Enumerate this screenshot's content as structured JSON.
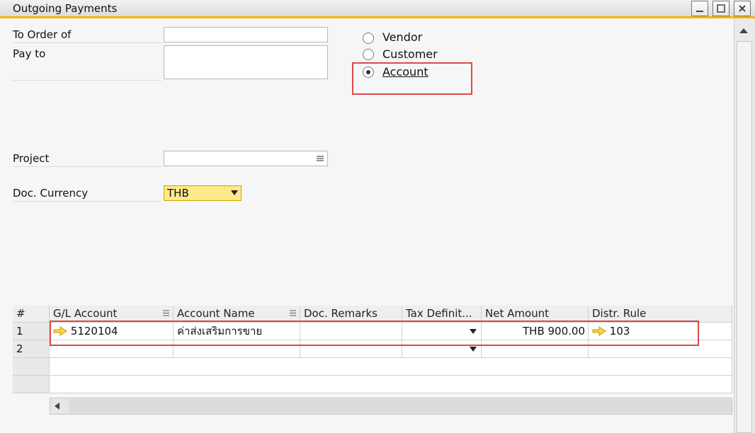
{
  "window": {
    "title": "Outgoing Payments"
  },
  "form": {
    "to_order_of_label": "To Order of",
    "pay_to_label": "Pay to",
    "project_label": "Project",
    "doc_currency_label": "Doc. Currency",
    "doc_currency_value": "THB",
    "to_order_of_value": "",
    "pay_to_value": "",
    "project_value": ""
  },
  "payment_type": {
    "options": [
      {
        "label": "Vendor",
        "selected": false
      },
      {
        "label": "Customer",
        "selected": false
      },
      {
        "label": "Account",
        "selected": true
      }
    ]
  },
  "grid": {
    "columns": [
      "#",
      "G/L Account",
      "Account Name",
      "Doc. Remarks",
      "Tax Definit...",
      "Net Amount",
      "Distr. Rule"
    ],
    "rows": [
      {
        "num": "1",
        "gl_account": "5120104",
        "account_name": "ค่าส่งเสริมการขาย",
        "doc_remarks": "",
        "tax_definition": "",
        "net_amount": "THB 900.00",
        "distr_rule": "103"
      },
      {
        "num": "2",
        "gl_account": "",
        "account_name": "",
        "doc_remarks": "",
        "tax_definition": "",
        "net_amount": "",
        "distr_rule": ""
      }
    ]
  },
  "colors": {
    "accent": "#f2b400",
    "highlight": "#e04848",
    "currency_field": "#fde98a"
  }
}
